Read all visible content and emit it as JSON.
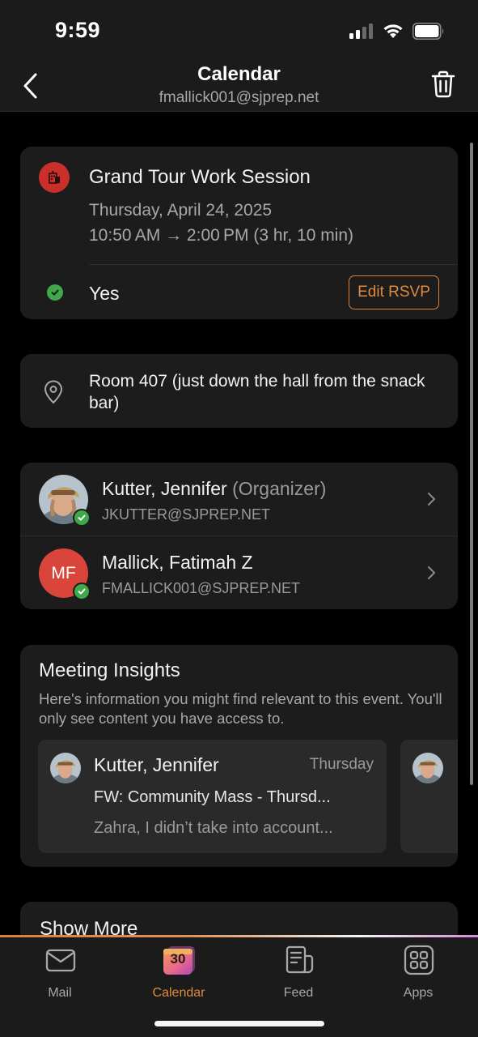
{
  "status_bar": {
    "time": "9:59"
  },
  "nav": {
    "title": "Calendar",
    "subtitle": "fmallick001@sjprep.net"
  },
  "event": {
    "title": "Grand Tour Work Session",
    "date": "Thursday, April 24, 2025",
    "time": "10:50 AM → 2:00 PM (3 hr, 10 min)",
    "rsvp_status": "Yes",
    "edit_rsvp_label": "Edit RSVP",
    "icon_color": "#c9302c"
  },
  "location": {
    "text": "Room 407 (just down the hall from the snack bar)"
  },
  "attendees": [
    {
      "name": "Kutter, Jennifer",
      "role": "(Organizer)",
      "email": "JKUTTER@SJPREP.NET",
      "avatar": "photo"
    },
    {
      "name": "Mallick, Fatimah Z",
      "role": "",
      "email": "FMALLICK001@SJPREP.NET",
      "initials": "MF",
      "avatar_color": "#d9453a"
    }
  ],
  "insights": {
    "title": "Meeting Insights",
    "description": "Here's information you might find relevant to this event. You'll only see content you have access to.",
    "items": [
      {
        "sender": "Kutter, Jennifer",
        "day": "Thursday",
        "subject": "FW: Community Mass - Thursd...",
        "preview": "Zahra, I didn’t take into account..."
      }
    ]
  },
  "show_more": {
    "label": "Show More"
  },
  "tabs": [
    {
      "label": "Mail",
      "icon": "mail-icon",
      "active": false
    },
    {
      "label": "Calendar",
      "icon": "calendar-icon",
      "active": true,
      "badge": "30"
    },
    {
      "label": "Feed",
      "icon": "feed-icon",
      "active": false
    },
    {
      "label": "Apps",
      "icon": "apps-icon",
      "active": false
    }
  ],
  "colors": {
    "accent": "#e08a3c",
    "success": "#3ea84a",
    "background": "#000000",
    "card": "#1c1c1c"
  }
}
